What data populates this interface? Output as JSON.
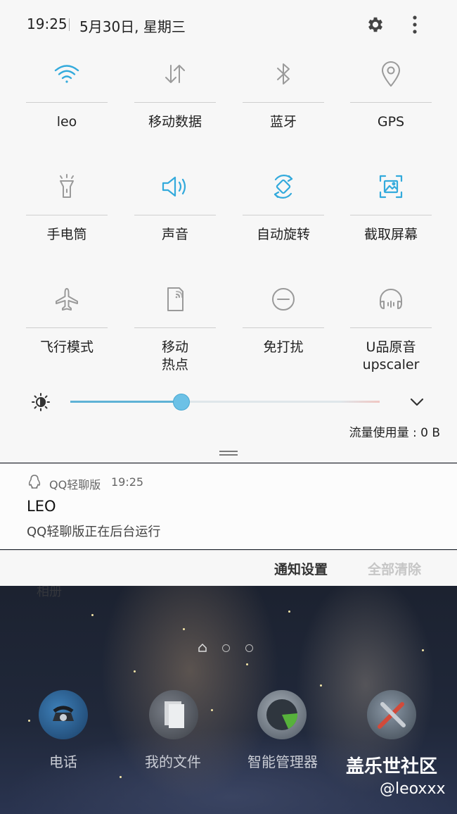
{
  "status_bar": {
    "time": "19:25",
    "date": "5月30日, 星期三",
    "settings_icon": "gear-icon",
    "more_icon": "more-vertical-icon"
  },
  "quick_settings": {
    "active_color": "#33aadc",
    "inactive_color": "#9a9a9a",
    "tiles": [
      {
        "label": "leo",
        "icon": "wifi-icon",
        "active": true
      },
      {
        "label": "移动数据",
        "icon": "mobile-data-icon",
        "active": false
      },
      {
        "label": "蓝牙",
        "icon": "bluetooth-icon",
        "active": false
      },
      {
        "label": "GPS",
        "icon": "location-pin-icon",
        "active": false
      },
      {
        "label": "手电筒",
        "icon": "flashlight-icon",
        "active": false
      },
      {
        "label": "声音",
        "icon": "speaker-icon",
        "active": true
      },
      {
        "label": "自动旋转",
        "icon": "auto-rotate-icon",
        "active": true
      },
      {
        "label": "截取屏幕",
        "icon": "screenshot-icon",
        "active": true
      },
      {
        "label": "飞行模式",
        "icon": "airplane-icon",
        "active": false
      },
      {
        "label": "移动\n热点",
        "icon": "hotspot-icon",
        "active": false
      },
      {
        "label": "免打扰",
        "icon": "do-not-disturb-icon",
        "active": false
      },
      {
        "label": "U品原音\nupscaler",
        "icon": "headphones-icon",
        "active": false
      }
    ],
    "brightness_level": 0.36,
    "data_usage": "流量使用量 : 0 B"
  },
  "notification": {
    "app_name": "QQ轻聊版",
    "time": "19:25",
    "title": "LEO",
    "body": "QQ轻聊版正在后台运行",
    "icon": "qq-penguin-icon"
  },
  "actions": {
    "notification_settings": "通知设置",
    "clear_all": "全部清除"
  },
  "home_screen": {
    "ghost_label": "相册",
    "apps": [
      {
        "label": "电话",
        "icon": "phone-icon"
      },
      {
        "label": "我的文件",
        "icon": "my-files-icon"
      },
      {
        "label": "智能管理器",
        "icon": "smart-manager-icon"
      },
      {
        "label": "",
        "icon": "tools-icon"
      }
    ],
    "watermark_brand": "盖乐世社区",
    "watermark_user": "@leoxxx"
  }
}
